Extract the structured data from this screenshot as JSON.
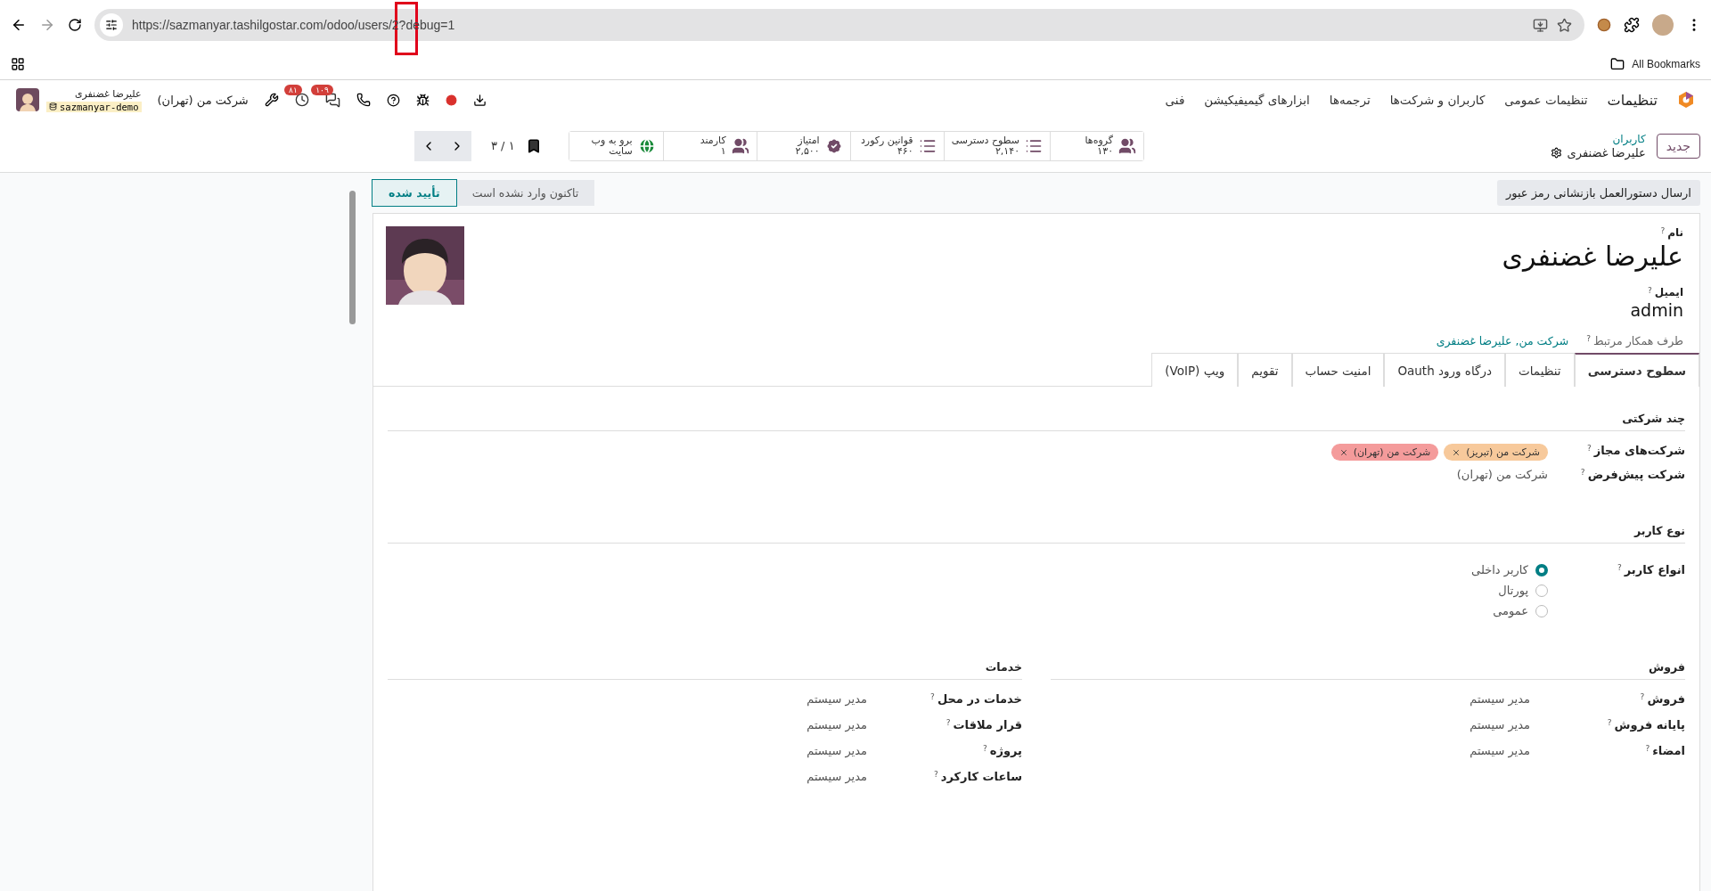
{
  "browser": {
    "url": "https://sazmanyar.tashilgostar.com/odoo/users/2?debug=1",
    "bookmarks": "All Bookmarks",
    "annotation": {
      "kind": "highlight"
    }
  },
  "navbar": {
    "app": "تنظیمات",
    "menus": [
      "تنظیمات عمومی",
      "کاربران و شرکت‌ها",
      "ترجمه‌ها",
      "ابزارهای گیمیفیکیشن",
      "فنی"
    ],
    "company": "شرکت من (تهران)",
    "user_name": "علیرضا غضنفری",
    "database": "sazmanyar-demo",
    "activity_count": "۸۱",
    "message_count": "۱۰۹"
  },
  "control_panel": {
    "new_button": "جدید",
    "breadcrumb": "کاربران",
    "record": "علیرضا غضنفری",
    "pager": "۱ / ۳",
    "smart_buttons": [
      {
        "kind": "groups",
        "label": "گروه‌ها",
        "value": "۱۳۰"
      },
      {
        "kind": "list",
        "label": "سطوح دسترسی",
        "value": "۲,۱۴۰"
      },
      {
        "kind": "list",
        "label": "قوانین رکورد",
        "value": "۴۶۰"
      },
      {
        "kind": "badge",
        "label": "امتیاز",
        "value": "۲,۵۰۰"
      },
      {
        "kind": "groups",
        "label": "کارمند",
        "value": "۱"
      },
      {
        "kind": "globe",
        "label": "برو به وب سایت"
      }
    ]
  },
  "status_bar": {
    "button": "ارسال دستورالعمل بازنشانی رمز عبور",
    "stages": [
      {
        "label": "تاکنون وارد نشده است",
        "selected": false
      },
      {
        "label": "تأیید شده",
        "selected": true
      }
    ]
  },
  "form": {
    "name_label": "نام",
    "name_help": "?",
    "name": "علیرضا غضنفری",
    "email_label": "ایمیل",
    "email_help": "?",
    "email": "admin",
    "partner_label": "طرف همکار مرتبط",
    "partner_help": "?",
    "partner": "شرکت من, علیرضا غضنفری",
    "tabs": [
      {
        "label": "سطوح دسترسی",
        "selected": true
      },
      {
        "label": "تنظیمات",
        "selected": false
      },
      {
        "label": "درگاه ورود Oauth",
        "selected": false
      },
      {
        "label": "امنیت حساب",
        "selected": false
      },
      {
        "label": "تقویم",
        "selected": false
      },
      {
        "label": "ویپ (VoIP)",
        "selected": false
      }
    ],
    "multi_company": {
      "title": "چند شرکتی",
      "allowed_label": "شرکت‌های مجاز",
      "allowed_help": "?",
      "allowed": [
        {
          "label": "شرکت من (تبریز)",
          "color": "#f7c99b"
        },
        {
          "label": "شرکت من (تهران)",
          "color": "#f49b9b"
        }
      ],
      "default_label": "شرکت پیش‌فرض",
      "default_help": "?",
      "default": "شرکت من (تهران)"
    },
    "user_type": {
      "title": "نوع کاربر",
      "label": "انواع کاربر",
      "help": "?",
      "options": [
        {
          "label": "کاربر داخلی",
          "selected": true
        },
        {
          "label": "پورتال",
          "selected": false
        },
        {
          "label": "عمومی",
          "selected": false
        }
      ]
    },
    "groups": [
      {
        "title": "فروش",
        "rows": [
          {
            "label": "فروش",
            "help": "?",
            "value": "مدیر سیستم"
          },
          {
            "label": "پایانه فروش",
            "help": "?",
            "value": "مدیر سیستم"
          },
          {
            "label": "امضاء",
            "help": "?",
            "value": "مدیر سیستم"
          }
        ]
      },
      {
        "title": "خدمات",
        "rows": [
          {
            "label": "خدمات در محل",
            "help": "?",
            "value": "مدیر سیستم"
          },
          {
            "label": "قرار ملاقات",
            "help": "?",
            "value": "مدیر سیستم"
          },
          {
            "label": "پروژه",
            "help": "?",
            "value": "مدیر سیستم"
          },
          {
            "label": "ساعات کارکرد",
            "help": "?",
            "value": "مدیر سیستم"
          }
        ]
      }
    ]
  }
}
